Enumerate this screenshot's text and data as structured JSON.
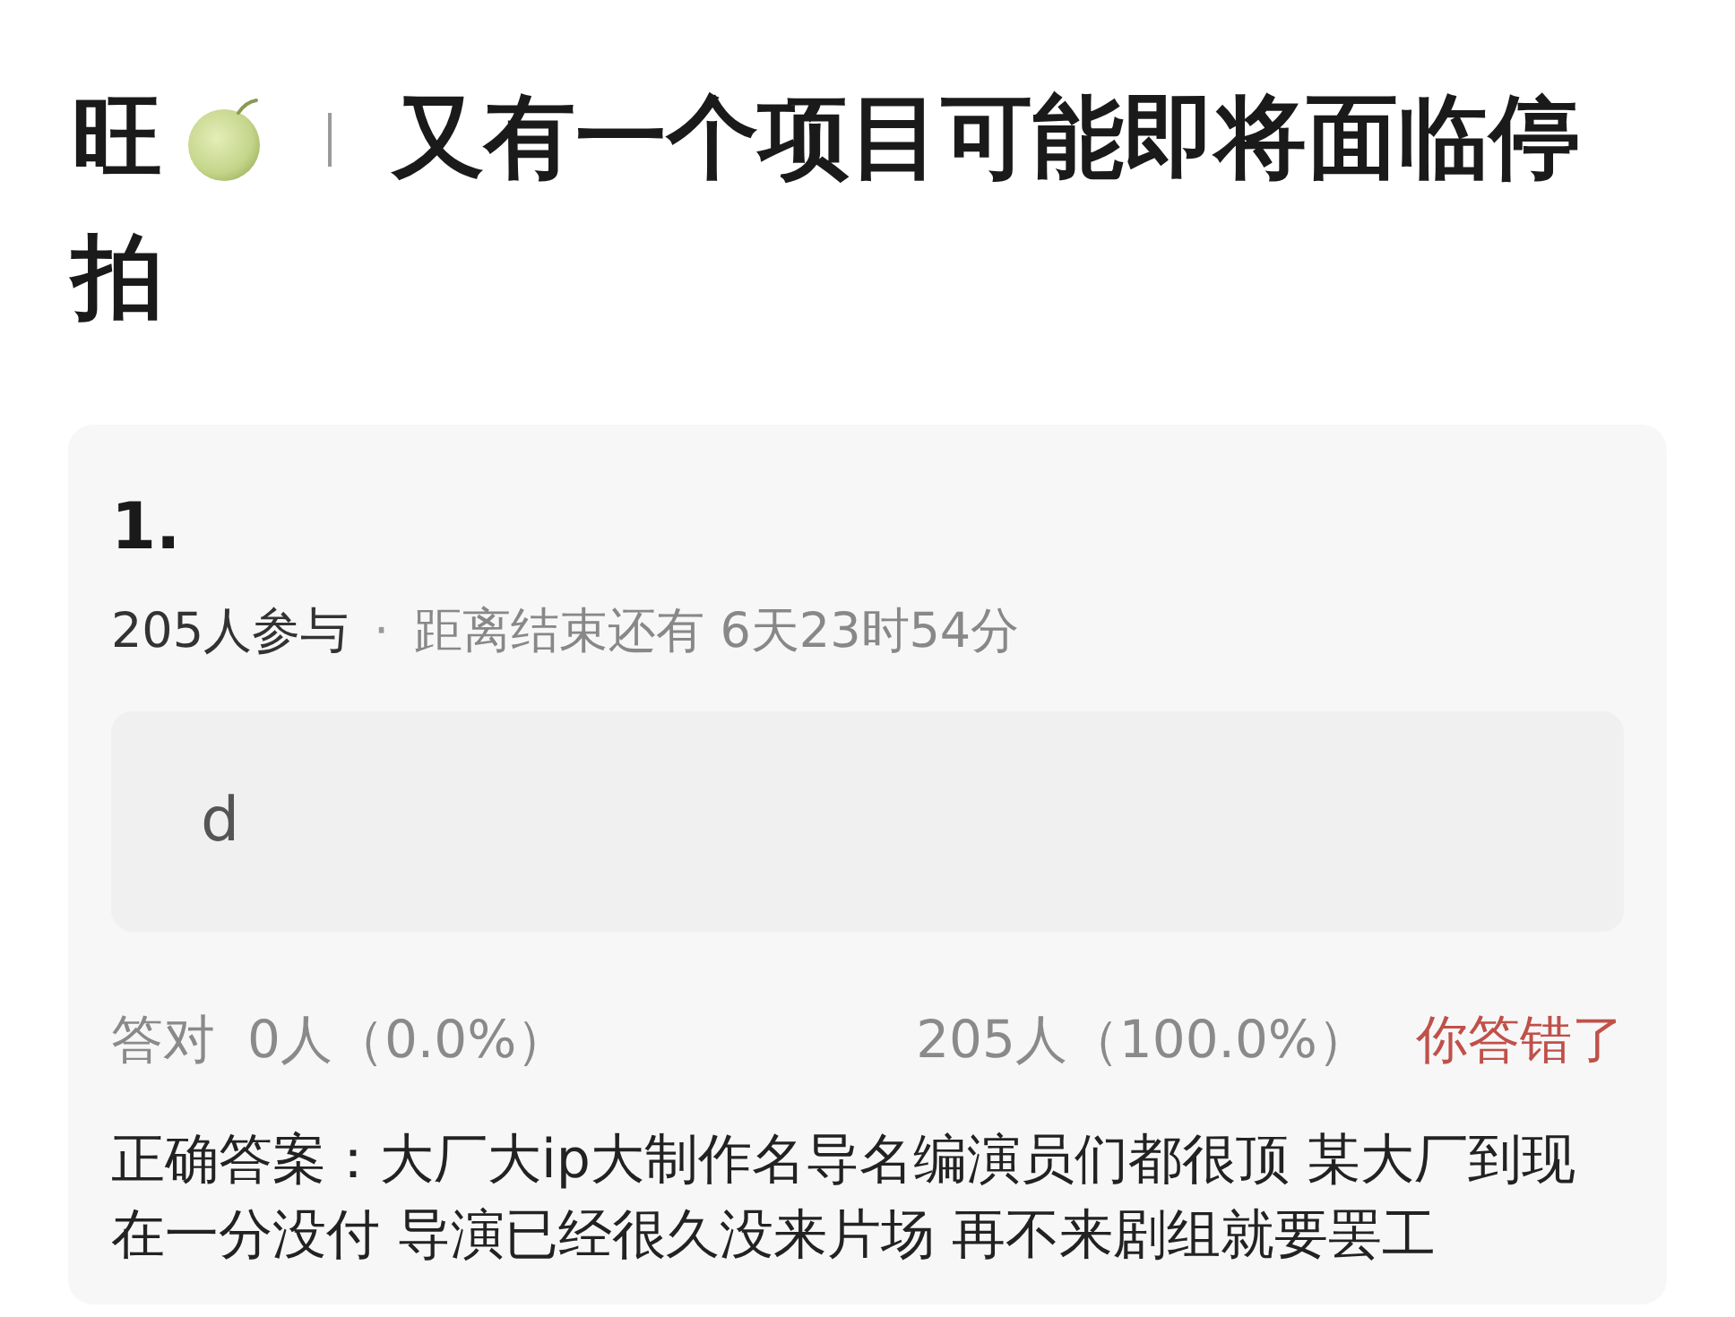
{
  "title": {
    "prefix": "旺",
    "lines": [
      "又有一个项目可能即将面临停",
      "拍"
    ]
  },
  "question": {
    "number": "1.",
    "participants": "205人参与",
    "separator": "·",
    "deadline": "距离结束还有 6天23时54分",
    "options": [
      {
        "label": "d"
      }
    ],
    "stats": {
      "correct_label": "答对",
      "correct_count": "0人（0.0%）",
      "wrong_count": "205人（100.0%）",
      "verdict": "你答错了",
      "correct": false
    },
    "answer": "正确答案：大厂大ip大制作名导名编演员们都很顶 某大厂到现在一分没付 导演已经很久没来片场 再不来剧组就要罢工"
  }
}
